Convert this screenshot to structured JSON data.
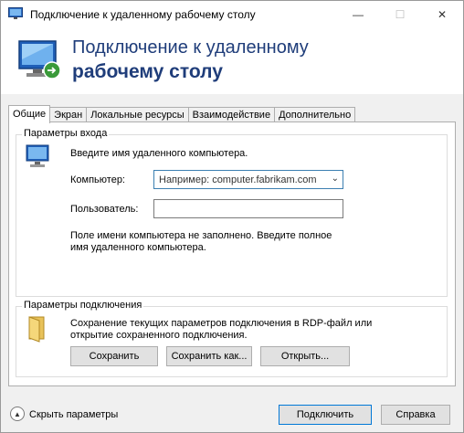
{
  "window": {
    "title": "Подключение к удаленному рабочему столу",
    "controls": {
      "minimize": "—",
      "maximize": "☐",
      "close": "✕"
    }
  },
  "header": {
    "line1": "Подключение к удаленному",
    "line2": "рабочему столу",
    "icon": "remote-desktop-icon"
  },
  "tabs": [
    {
      "label": "Общие",
      "active": true
    },
    {
      "label": "Экран"
    },
    {
      "label": "Локальные ресурсы"
    },
    {
      "label": "Взаимодействие"
    },
    {
      "label": "Дополнительно"
    }
  ],
  "login": {
    "group_label": "Параметры входа",
    "prompt": "Введите имя удаленного компьютера.",
    "computer_label": "Компьютер:",
    "computer_value": "Например: computer.fabrikam.com",
    "user_label": "Пользователь:",
    "user_value": "",
    "warning_line1": "Поле имени компьютера не заполнено. Введите полное",
    "warning_line2": "имя удаленного компьютера."
  },
  "connection": {
    "group_label": "Параметры подключения",
    "desc_line1": "Сохранение текущих параметров подключения в RDP-файл или",
    "desc_line2": "открытие сохраненного подключения.",
    "save_label": "Сохранить",
    "save_as_label": "Сохранить как...",
    "open_label": "Открыть..."
  },
  "footer": {
    "hide_options_label": "Скрыть параметры",
    "connect_label": "Подключить",
    "help_label": "Справка"
  }
}
